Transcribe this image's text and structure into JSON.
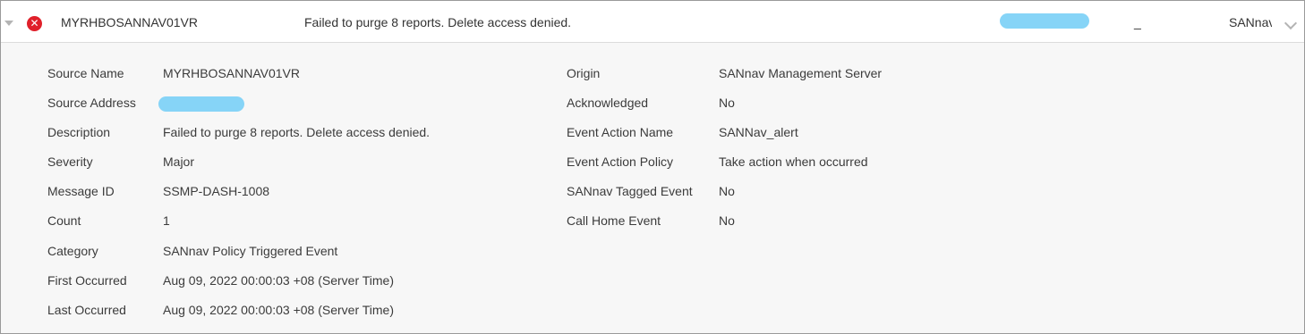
{
  "colors": {
    "severity_error": "#e0202a",
    "redaction": "#86d4f7",
    "details_bg": "#f7f7f7"
  },
  "event_row": {
    "source_name": "MYRHBOSANNAV01VR",
    "description": "Failed to purge 8 reports. Delete access denied.",
    "dash": "_",
    "origin_truncated": "SANnav",
    "severity_icon": "error-x-icon",
    "severity_glyph": "✕"
  },
  "details": {
    "left": [
      {
        "label": "Source Name",
        "value": "MYRHBOSANNAV01VR"
      },
      {
        "label": "Source Address",
        "value": ""
      },
      {
        "label": "Description",
        "value": "Failed to purge 8 reports. Delete access denied."
      },
      {
        "label": "Severity",
        "value": "Major"
      },
      {
        "label": "Message ID",
        "value": "SSMP-DASH-1008"
      },
      {
        "label": "Count",
        "value": "1"
      },
      {
        "label": "Category",
        "value": "SANnav Policy Triggered Event"
      },
      {
        "label": "First Occurred",
        "value": "Aug 09, 2022 00:00:03 +08 (Server Time)"
      },
      {
        "label": "Last Occurred",
        "value": "Aug 09, 2022 00:00:03 +08 (Server Time)"
      }
    ],
    "right": [
      {
        "label": "Origin",
        "value": "SANnav Management Server"
      },
      {
        "label": "Acknowledged",
        "value": "No"
      },
      {
        "label": "Event Action Name",
        "value": "SANNav_alert"
      },
      {
        "label": "Event Action Policy",
        "value": "Take action when occurred"
      },
      {
        "label": "SANnav Tagged Event",
        "value": "No"
      },
      {
        "label": "Call Home Event",
        "value": "No"
      }
    ]
  }
}
